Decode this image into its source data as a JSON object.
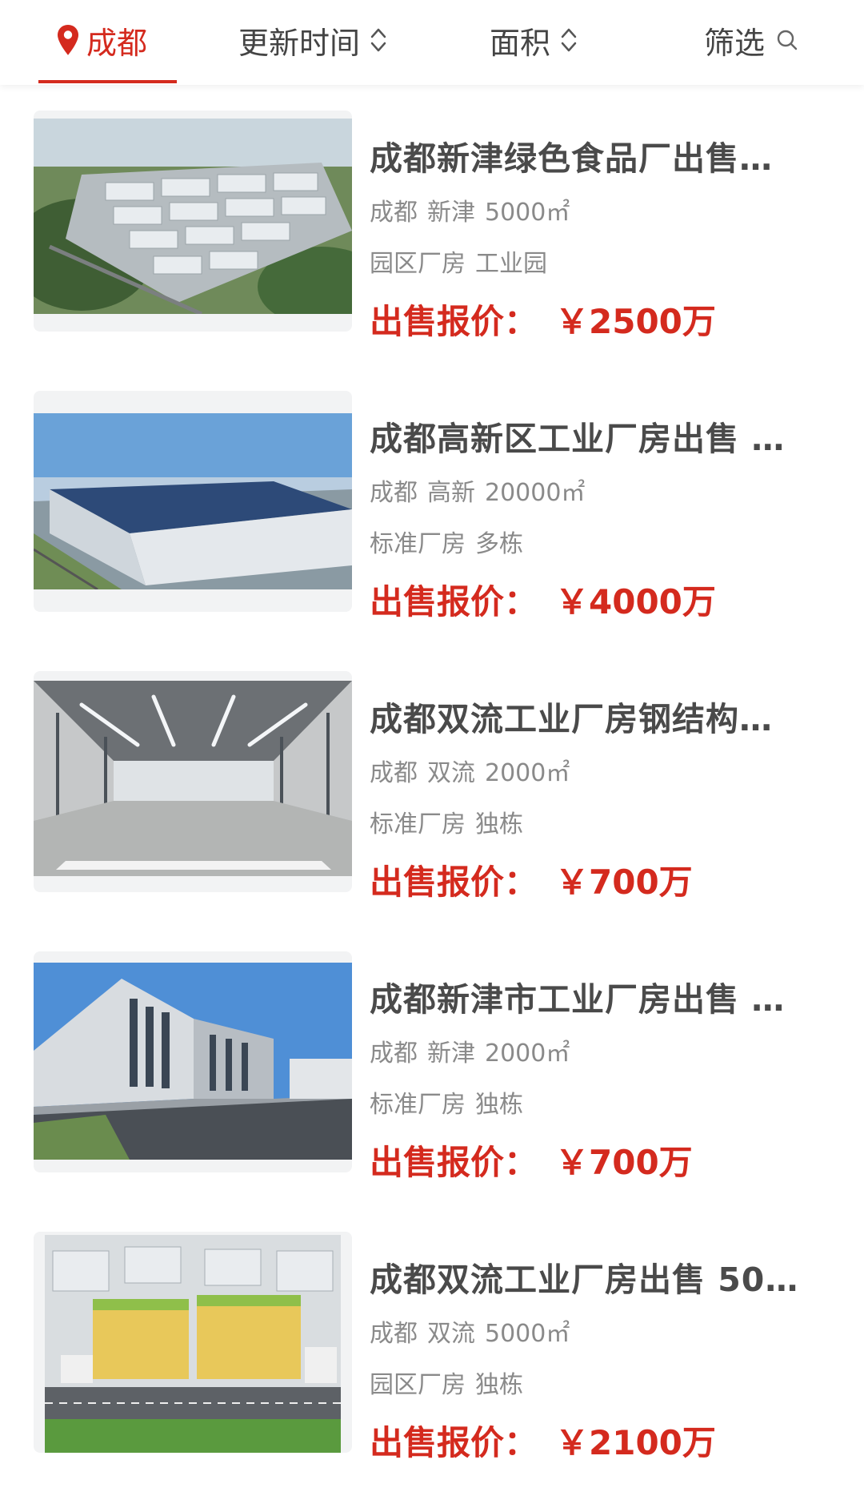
{
  "filter_bar": {
    "city": "成都",
    "sort_time": "更新时间",
    "sort_area": "面积",
    "filter": "筛选"
  },
  "icons": {
    "location": "map-pin-icon",
    "sort": "sort-up-down-icon",
    "search": "search-icon"
  },
  "colors": {
    "accent": "#d42a1e",
    "title": "#4a4a4a",
    "meta": "#8a8a8a"
  },
  "listings": [
    {
      "title": "成都新津绿色食品厂出售…",
      "city": "成都",
      "district": "新津",
      "area": "5000㎡",
      "tag1": "园区厂房",
      "tag2": "工业园",
      "price_label": "出售报价：",
      "price": "￥2500万"
    },
    {
      "title": "成都高新区工业厂房出售 …",
      "city": "成都",
      "district": "高新",
      "area": "20000㎡",
      "tag1": "标准厂房",
      "tag2": "多栋",
      "price_label": "出售报价：",
      "price": "￥4000万"
    },
    {
      "title": "成都双流工业厂房钢结构…",
      "city": "成都",
      "district": "双流",
      "area": "2000㎡",
      "tag1": "标准厂房",
      "tag2": "独栋",
      "price_label": "出售报价：",
      "price": "￥700万"
    },
    {
      "title": "成都新津市工业厂房出售 …",
      "city": "成都",
      "district": "新津",
      "area": "2000㎡",
      "tag1": "标准厂房",
      "tag2": "独栋",
      "price_label": "出售报价：",
      "price": "￥700万"
    },
    {
      "title": "成都双流工业厂房出售 50…",
      "city": "成都",
      "district": "双流",
      "area": "5000㎡",
      "tag1": "园区厂房",
      "tag2": "独栋",
      "price_label": "出售报价：",
      "price": "￥2100万"
    }
  ]
}
